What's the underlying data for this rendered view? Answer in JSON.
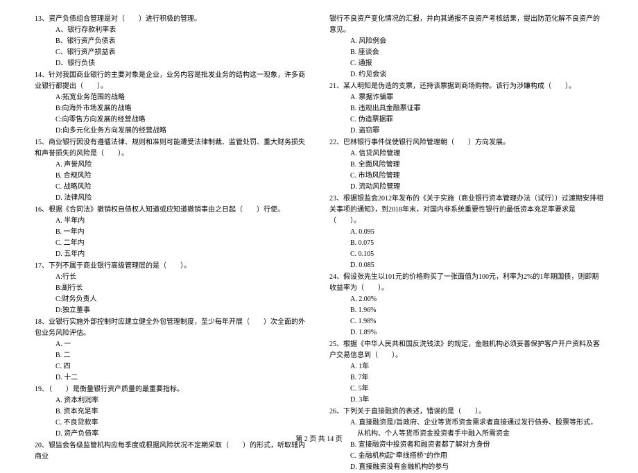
{
  "footer": "第 2 页 共 14 页",
  "left": {
    "q13": {
      "text": "13、资产负债组合管理是对（　　）进行积极的管理。",
      "a": "A、银行存款利率表",
      "b": "B、银行资产负债表",
      "c": "C、银行资产损益表",
      "d": "D、银行负债"
    },
    "q14": {
      "text": "14、针对我国商业银行的主要对象是企业，业务内容是批发业务的结构这一现象，许多商业银行都提出（　　）。",
      "a": "A:拓宽业务范围的战略",
      "b": "B:向海外市场发展的战略",
      "c": "C:向零售方向发展的经营战略",
      "d": "D:向多元化业务方向发展的经营战略"
    },
    "q15": {
      "text": "15、商业银行因没有遵循法律、规则和准则可能遭受法律制裁、监管处罚、重大财务损失和声誉损失的风险是（　　）。",
      "a": "A. 声誉风险",
      "b": "B. 合规风险",
      "c": "C. 战略风险",
      "d": "D. 法律风险"
    },
    "q16": {
      "text": "16、根据《合同法》撤销权自债权人知道或应知道撤销事由之日起（　　）行使。",
      "a": "A. 半年内",
      "b": "B. 一年内",
      "c": "C. 二年内",
      "d": "D. 五年内"
    },
    "q17": {
      "text": "17、下列不属于商业银行高级管理层的是（　　）。",
      "a": "A:行长",
      "b": "B:副行长",
      "c": "C:财务负责人",
      "d": "D:独立董事"
    },
    "q18": {
      "text": "18、业银行实施外部控制时应建立健全外包管理制度，至少每年开展（　　）次全面的外包业务风险评估。",
      "a": "A. 一",
      "b": "B. 二",
      "c": "C. 四",
      "d": "D. 十二"
    },
    "q19": {
      "text": "19、（　　）是衡量银行资产质量的最重要指标。",
      "a": "A. 资本利润率",
      "b": "B. 资本充足率",
      "c": "C. 不良贷款率",
      "d": "D. 资产负债率"
    },
    "q20": {
      "text": "20、银监会各级监管机构应每季度或根据风险状况不定期采取（　　）的形式，听取辖内商业"
    }
  },
  "right": {
    "q20cont": "银行不良资产变化情况的汇报，并向其通报不良资产考核结果，提出防范化解不良资产的意见。",
    "q20o": {
      "a": "A. 风险例会",
      "b": "B. 座谈会",
      "c": "C. 通报",
      "d": "D. 约见会谈"
    },
    "q21": {
      "text": "21、某人明知是伪造的支票，还持该票据到商场购物。该行为涉嫌构成（　　）。",
      "a": "A. 票据诈骗罪",
      "b": "B. 违规出具金融票证罪",
      "c": "C. 伪造票据罪",
      "d": "D. 盗窃罪"
    },
    "q22": {
      "text": "22、巴林银行事件促使银行风险管理朝（　　）方向发展。",
      "a": "A. 信贷风险管理",
      "b": "B. 全面风险管理",
      "c": "C. 市场风险管理",
      "d": "D. 流动风险管理"
    },
    "q23": {
      "text": "23、根据银监会2012年发布的《关于实施（商业银行资本管理办法（试行））过渡期安排相关事项的通知》，到2018年末，对国内非系统重要性银行的最低资本充足率要求是（　　）。",
      "a": "A. 0.095",
      "b": "B. 0.075",
      "c": "C. 0.105",
      "d": "D. 0.085"
    },
    "q24": {
      "text": "24、假设张先生以101元的价格购买了一张面值为100元，利率为2%的1年期国债，则即期收益率为（　　）。",
      "a": "A. 2.00%",
      "b": "B. 1.96%",
      "c": "C. 1.98%",
      "d": "D. 1.89%"
    },
    "q25": {
      "text": "25、根据《中华人民共和国反洗钱法》的规定，金融机构必须妥善保护客户开户资料及客户交易信息到（　　）。",
      "a": "A. 1年",
      "b": "B. 7年",
      "c": "C. 5年",
      "d": "D. 3年"
    },
    "q26": {
      "text": "26、下列关于直接融资的表述，错误的是（　　）。",
      "a": "A. 直接融资是J旨政府、企业等货币资金需求者直接通过发行债券、股票等形式，从机构、个人等货币资金投资者手中融入所需资金",
      "b": "B. 宣接融资中投资者和融资者都了解对方身份",
      "c": "C. 金融机构起\"牵线搭桥\"的作用",
      "d": "D. 直接融资没有金融机构的参与"
    }
  }
}
